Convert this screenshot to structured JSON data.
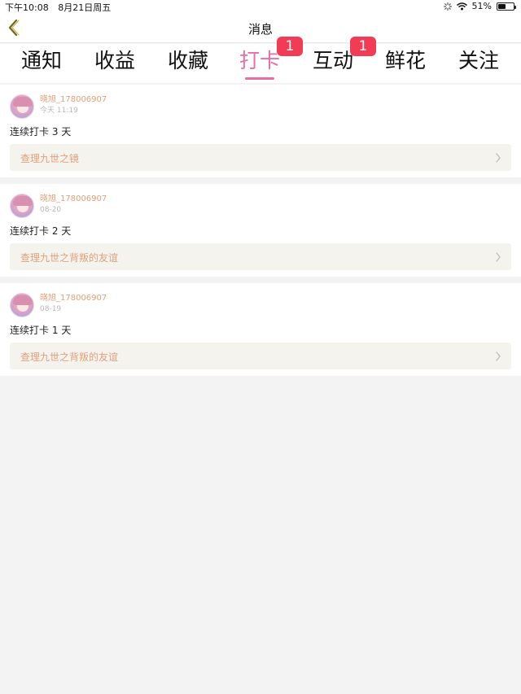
{
  "status_bar": {
    "time": "下午10:08",
    "date": "8月21日周五",
    "battery": "51%",
    "battery_level": 0.51
  },
  "nav": {
    "title": "消息",
    "back_icon": "chevron-left-icon"
  },
  "tabs": [
    {
      "label": "通知",
      "active": false,
      "badge": ""
    },
    {
      "label": "收益",
      "active": false,
      "badge": ""
    },
    {
      "label": "收藏",
      "active": false,
      "badge": ""
    },
    {
      "label": "打卡",
      "active": true,
      "badge": "1"
    },
    {
      "label": "互动",
      "active": false,
      "badge": "1"
    },
    {
      "label": "鲜花",
      "active": false,
      "badge": ""
    },
    {
      "label": "关注",
      "active": false,
      "badge": ""
    }
  ],
  "colors": {
    "accent": "#ea6ea6",
    "badge": "#f23b55",
    "link": "#e0a07a"
  },
  "messages": [
    {
      "username": "晓旭_178006907",
      "time": "今天 11:19",
      "content": "连续打卡 3 天",
      "link": "查理九世之镜"
    },
    {
      "username": "晓旭_178006907",
      "time": "08-20",
      "content": "连续打卡 2 天",
      "link": "查理九世之背叛的友谊"
    },
    {
      "username": "晓旭_178006907",
      "time": "08-19",
      "content": "连续打卡 1 天",
      "link": "查理九世之背叛的友谊"
    }
  ]
}
